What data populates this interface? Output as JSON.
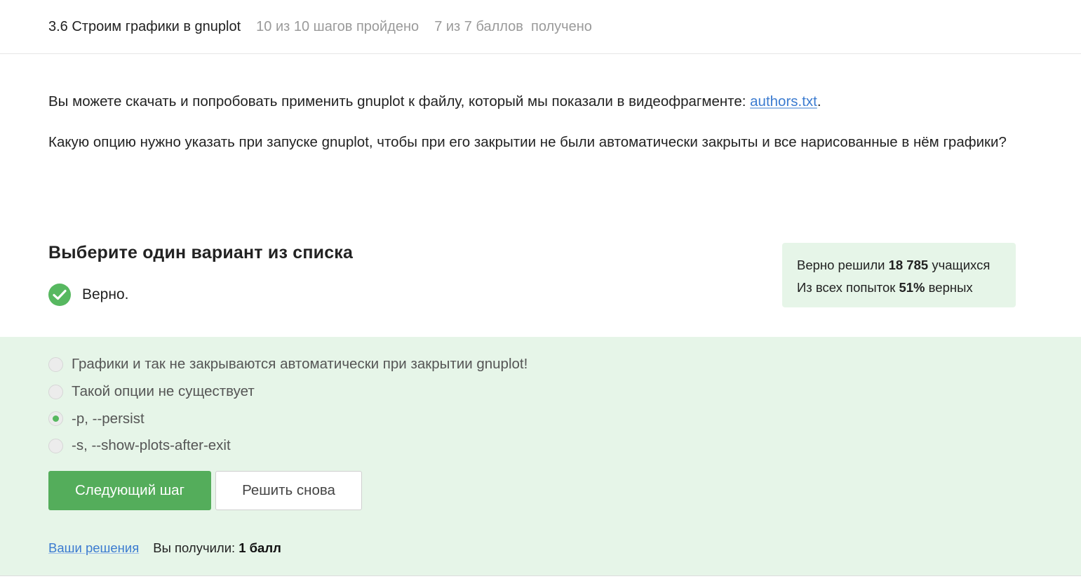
{
  "header": {
    "lesson_title": "3.6 Строим графики в gnuplot",
    "progress": "10 из 10 шагов пройдено",
    "score": "7 из 7 баллов  получено"
  },
  "content": {
    "para1_prefix": "Вы можете скачать и попробовать применить gnuplot к файлу, который мы показали в видеофрагменте: ",
    "para1_link": "authors.txt",
    "para1_suffix": ".",
    "para2": "Какую опцию нужно указать при запуске gnuplot, чтобы при его закрытии не были автоматически закрыты и все нарисованные в нём графики?"
  },
  "quiz": {
    "title": "Выберите один вариант из списка",
    "verdict": "Верно.",
    "check_color": "#57b860"
  },
  "stats": {
    "solved_prefix": "Верно решили ",
    "solved_count": "18 785",
    "solved_suffix": " учащихся",
    "attempts_prefix": "Из всех попыток ",
    "attempts_percent": "51%",
    "attempts_suffix": " верных"
  },
  "options": [
    {
      "label": "Графики и так не закрываются автоматически при закрытии gnuplot!",
      "selected": false
    },
    {
      "label": "Такой опции не существует",
      "selected": false
    },
    {
      "label": "-p, --persist",
      "selected": true
    },
    {
      "label": "-s, --show-plots-after-exit",
      "selected": false
    }
  ],
  "buttons": {
    "next": "Следующий шаг",
    "retry": "Решить снова"
  },
  "footer": {
    "solutions_link": "Ваши решения",
    "got_label": "Вы получили:",
    "points": "1 балл"
  },
  "colors": {
    "accent_green": "#54ad5b",
    "answer_bg": "#e6f5e8",
    "link": "#3b7bd0"
  }
}
